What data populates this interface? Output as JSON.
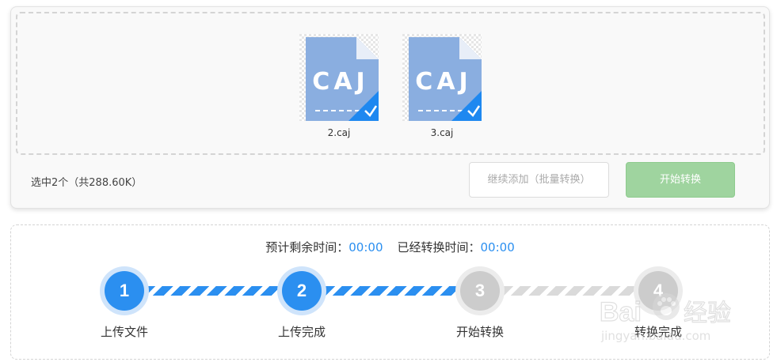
{
  "files": [
    {
      "name": "2.caj",
      "badge_text": "CAJ"
    },
    {
      "name": "3.caj",
      "badge_text": "CAJ"
    }
  ],
  "summary_text": "选中2个（共288.60K）",
  "buttons": {
    "continue_label": "继续添加（批量转换）",
    "start_label": "开始转换"
  },
  "progress": {
    "remaining_label": "预计剩余时间：",
    "remaining_value": "00:00",
    "elapsed_label": "已经转换时间：",
    "elapsed_value": "00:00"
  },
  "steps": [
    {
      "number": "1",
      "label": "上传文件",
      "state": "done"
    },
    {
      "number": "2",
      "label": "上传完成",
      "state": "done"
    },
    {
      "number": "3",
      "label": "开始转换",
      "state": "pending"
    },
    {
      "number": "4",
      "label": "转换完成",
      "state": "pending"
    }
  ],
  "watermark": {
    "brand": "Bai",
    "brand_suffix": "经验",
    "url": "jingyan.baidu.com"
  },
  "colors": {
    "accent": "#2b8ff0",
    "file_icon": "#8aaee0",
    "start_button": "#9fd49f",
    "inactive": "#cccccc"
  }
}
